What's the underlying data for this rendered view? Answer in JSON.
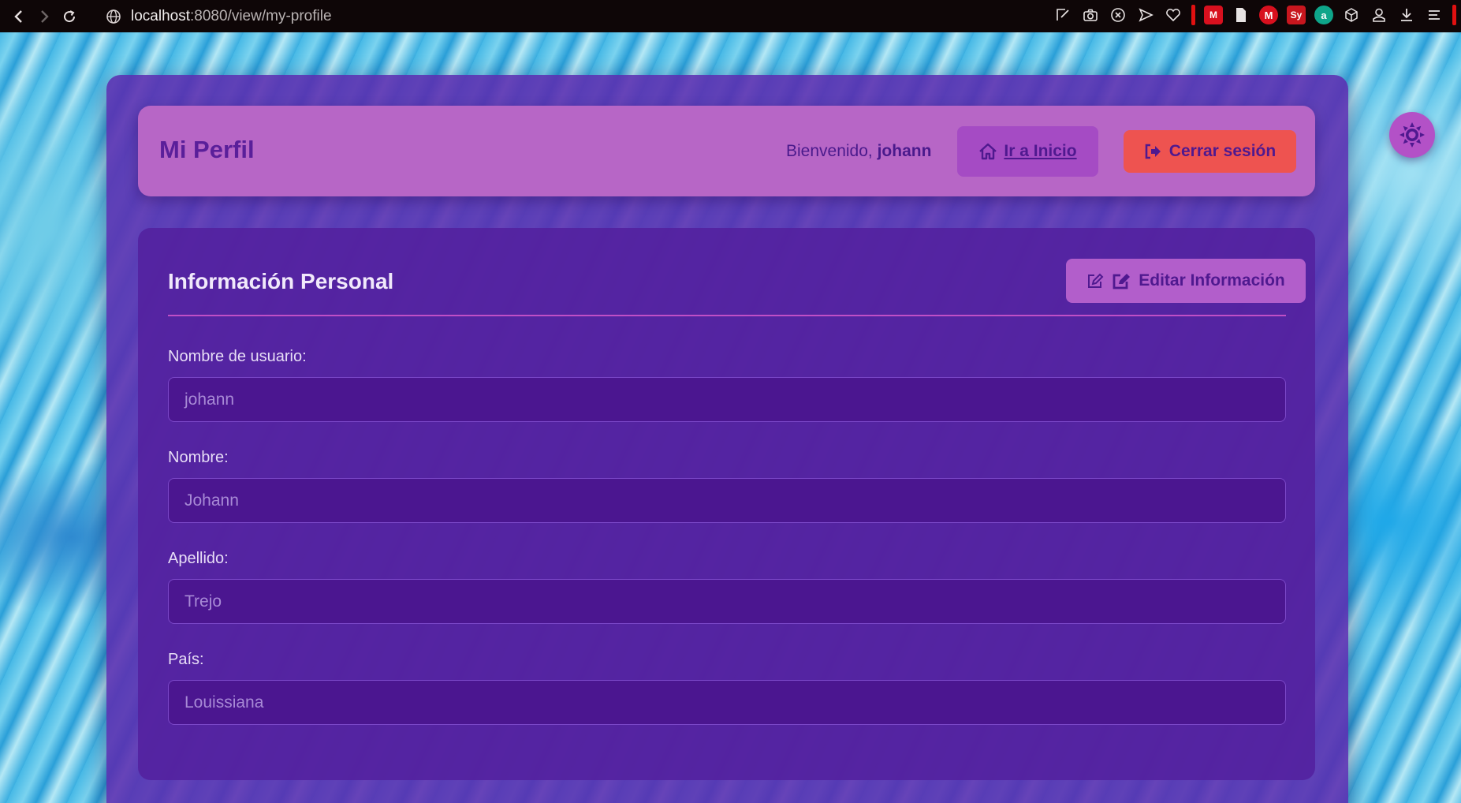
{
  "browser": {
    "url_host": "localhost",
    "url_path": ":8080/view/my-profile",
    "nav": {
      "back_icon": "chevron-left-icon",
      "forward_icon": "chevron-right-icon",
      "reload_icon": "reload-icon"
    },
    "extensions": [
      "edit-icon",
      "camera-icon",
      "close-circle-icon",
      "send-icon",
      "heart-icon",
      "mendeley-icon",
      "file-icon",
      "m-icon",
      "sy-icon",
      "a-icon",
      "box-icon",
      "account-icon",
      "download-icon",
      "menu-icon"
    ],
    "ext_labels": {
      "mendeley": "M",
      "m": "M",
      "sy": "Sy",
      "a": "a"
    }
  },
  "header": {
    "title": "Mi Perfil",
    "welcome_prefix": "Bienvenido, ",
    "username": "johann",
    "home_label": "Ir a Inicio",
    "logout_label": "Cerrar sesión"
  },
  "section": {
    "title": "Información Personal",
    "edit_label": "Editar Información"
  },
  "fields": [
    {
      "label": "Nombre de usuario:",
      "value": "johann"
    },
    {
      "label": "Nombre:",
      "value": "Johann"
    },
    {
      "label": "Apellido:",
      "value": "Trejo"
    },
    {
      "label": "País:",
      "value": "Louissiana"
    }
  ],
  "colors": {
    "card": "#5b2caf",
    "header": "#b766c6",
    "logout": "#ee5350",
    "accent_text": "#5a1f9a",
    "theme_toggle": "#b351c7"
  },
  "theme_toggle_icon": "sun-icon"
}
